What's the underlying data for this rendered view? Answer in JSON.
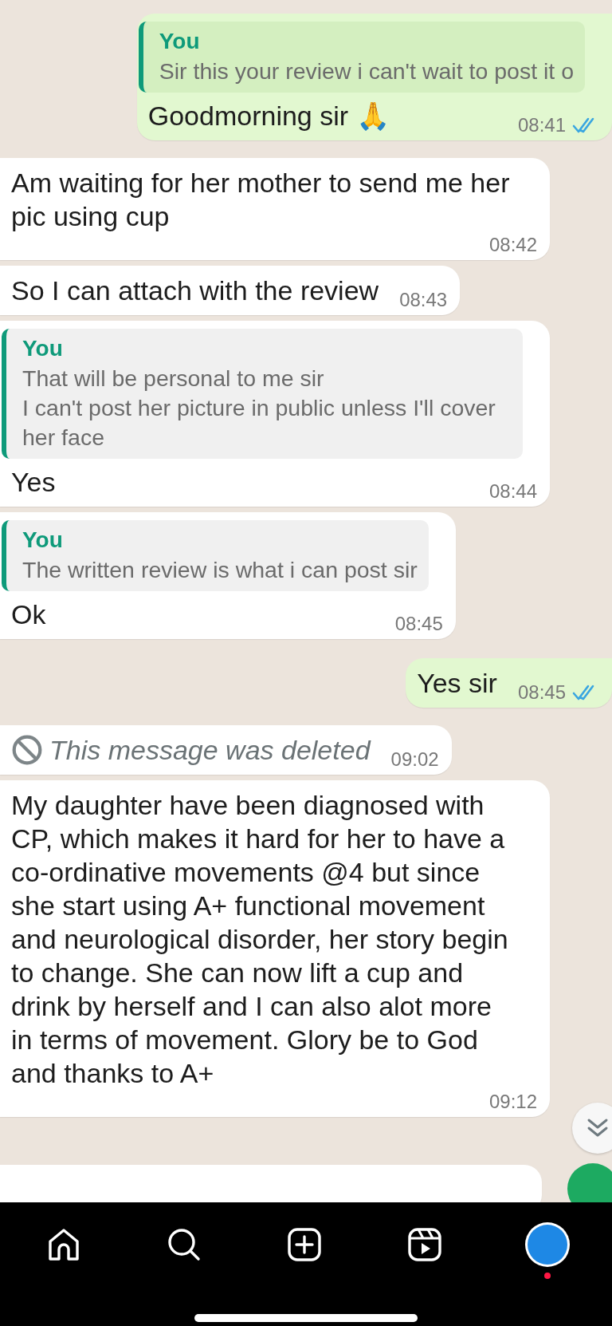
{
  "messages": [
    {
      "sent": true,
      "kind": "text",
      "quote": {
        "author": "You",
        "text": "Sir this your review i can't wait to post it o"
      },
      "text": "Goodmorning sir 🙏",
      "time": "08:41",
      "read": true
    },
    {
      "sent": false,
      "kind": "text",
      "text": "Am waiting for her mother to send me her pic using cup",
      "time": "08:42"
    },
    {
      "sent": false,
      "kind": "text",
      "text": "So I can attach with the review",
      "time": "08:43"
    },
    {
      "sent": false,
      "kind": "text",
      "quote": {
        "author": "You",
        "text": "That will be personal to me sir\nI can't post her picture in public unless I'll cover her face"
      },
      "text": "Yes",
      "time": "08:44"
    },
    {
      "sent": false,
      "kind": "text",
      "quote": {
        "author": "You",
        "text": "The written review is what i can post sir"
      },
      "text": "Ok",
      "time": "08:45"
    },
    {
      "sent": true,
      "kind": "text",
      "text": "Yes sir",
      "time": "08:45",
      "read": true
    },
    {
      "sent": false,
      "kind": "deleted",
      "text": "This message was deleted",
      "time": "09:02"
    },
    {
      "sent": false,
      "kind": "text",
      "text": "My daughter have been diagnosed with CP, which makes it hard for her to have a co-ordinative movements @4 but since she start using A+ functional movement and neurological disorder, her story begin to change. She can now lift a cup and drink by herself and I can also alot more in terms of movement. Glory be to God and thanks to A+",
      "time": "09:12"
    }
  ],
  "nav": {
    "items": [
      {
        "kind": "home"
      },
      {
        "kind": "search"
      },
      {
        "kind": "create"
      },
      {
        "kind": "reels"
      },
      {
        "kind": "profile",
        "notification": true
      }
    ]
  }
}
